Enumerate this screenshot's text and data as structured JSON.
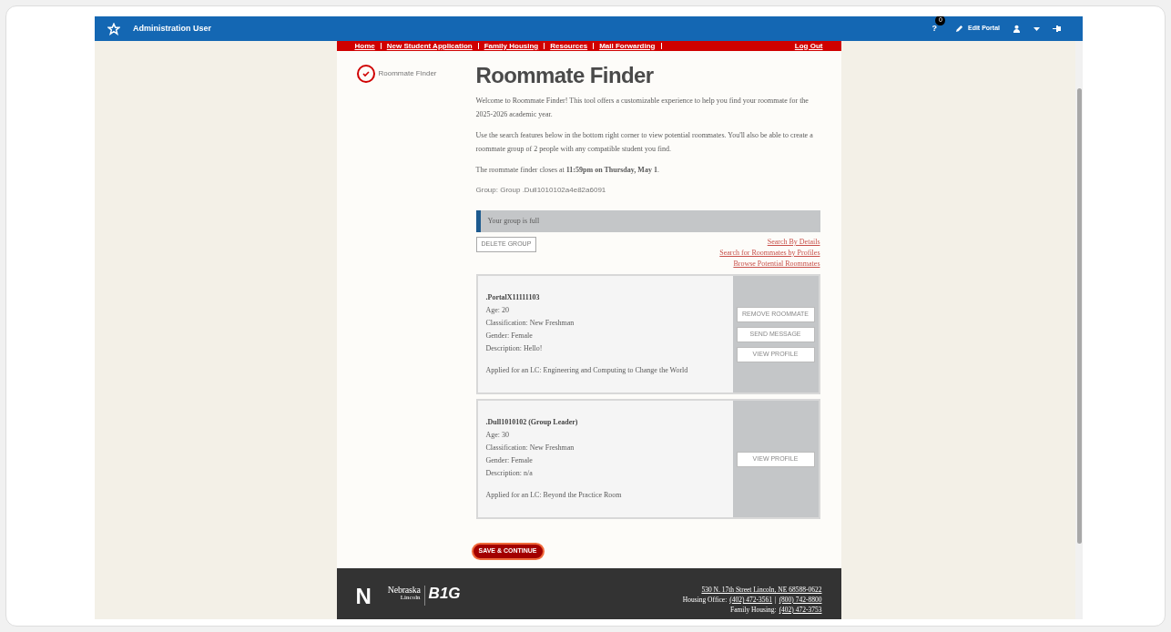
{
  "topbar": {
    "user": "Administration User",
    "notification_count": "0",
    "help": "?",
    "edit_portal": "Edit Portal"
  },
  "site_nav": {
    "links": [
      "Home",
      "New Student Application",
      "Family Housing",
      "Resources",
      "Mail Forwarding"
    ],
    "logout": "Log Out"
  },
  "sidebar": {
    "items": [
      {
        "label": "Roommate Finder",
        "checked": true
      }
    ]
  },
  "page": {
    "title": "Roommate Finder",
    "paragraphs": [
      "Welcome to Roommate Finder! This tool offers a customizable experience to help you find your roommate for the 2025-2026 academic year.",
      "Use the search features below in the bottom right corner to view potential roommates. You'll also be able to create a roommate group of 2 people with any compatible student you find.",
      "The roommate finder closes at **11:59pm on Thursday, May 1**."
    ],
    "group": "Group: Group .Dull1010102a4e82a6091",
    "notice": "Your group is full",
    "delete_button": "DELETE GROUP",
    "search_links": [
      "Search By Details",
      "Search for Roommates by Profiles",
      "Browse Potential Roommates"
    ],
    "roommates": [
      {
        "name": ".PortalX11111103",
        "details": [
          "Age: 20",
          "Classification: New Freshman",
          "Gender: Female",
          "Description: Hello!"
        ],
        "lc": "Applied for an LC: Engineering and Computing to Change the World",
        "actions": [
          "REMOVE ROOMMATE",
          "SEND MESSAGE",
          "VIEW PROFILE"
        ]
      },
      {
        "name": ".Dull1010102 (Group Leader)",
        "details": [
          "Age: 30",
          "Classification: New Freshman",
          "Gender: Female",
          "Description: n/a"
        ],
        "lc": "Applied for an LC: Beyond the Practice Room",
        "actions": [
          "VIEW PROFILE"
        ]
      }
    ],
    "save_button": "SAVE & CONTINUE"
  },
  "footer": {
    "logo_n": "N",
    "logo_nebraska": "Nebraska",
    "logo_lincoln": "Lincoln",
    "logo_big": "B1G",
    "address": "530 N. 17th Street Lincoln, NE 68588-0622",
    "housing_label": "Housing Office:",
    "housing_phone_1": "(402) 472-3561",
    "separator": "|",
    "housing_phone_2": "(800) 742-8800",
    "family_label": "Family Housing:",
    "family_phone": "(402) 472-3753"
  }
}
